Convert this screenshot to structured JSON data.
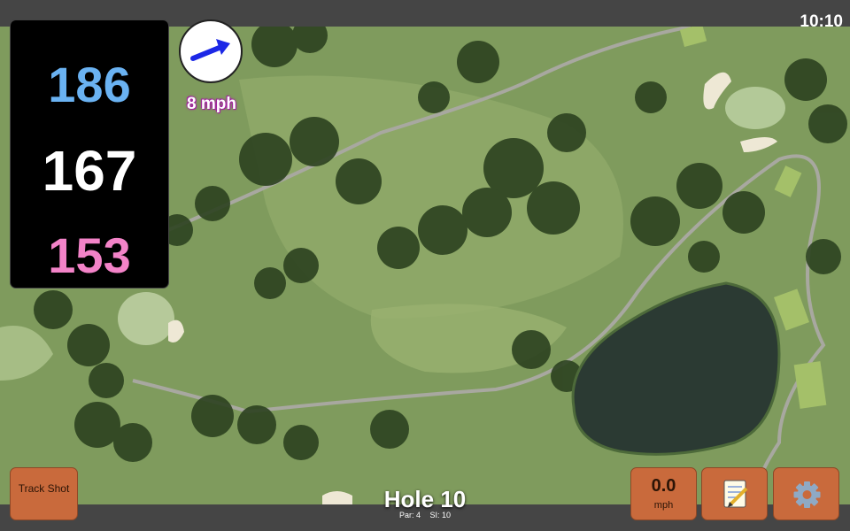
{
  "status": {
    "time": "10:10"
  },
  "distances": {
    "back": "186",
    "middle": "167",
    "front": "153"
  },
  "wind": {
    "speed_label": "8 mph",
    "direction_icon": "arrow-east-northeast"
  },
  "buttons": {
    "track_shot_label": "Track Shot",
    "wind_value": "0.0",
    "wind_unit": "mph",
    "notes_icon": "notepad-icon",
    "settings_icon": "gear-icon"
  },
  "hole": {
    "title": "Hole 10",
    "par_label": "Par: 4",
    "si_label": "SI: 10"
  },
  "colors": {
    "back_distance": "#6ab2f2",
    "middle_distance": "#ffffff",
    "front_distance": "#f383c8",
    "button_bg": "#c96a3c",
    "wind_text_glow": "#a21fa0"
  }
}
